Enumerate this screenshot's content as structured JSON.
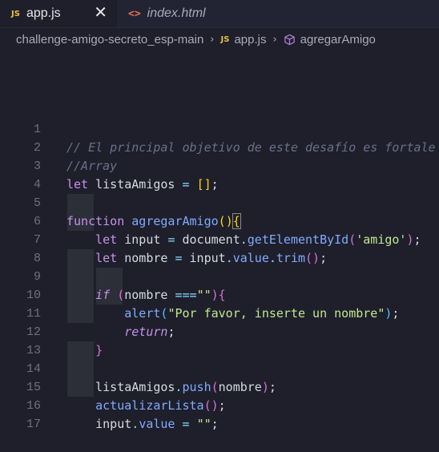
{
  "tabs": [
    {
      "label": "app.js",
      "icon": "JS",
      "active": true,
      "close": "✕"
    },
    {
      "label": "index.html",
      "icon": "<>",
      "active": false
    }
  ],
  "breadcrumb": {
    "folder": "challenge-amigo-secreto_esp-main",
    "file_icon": "JS",
    "file": "app.js",
    "symbol": "agregarAmigo"
  },
  "editor": {
    "line_numbers": [
      "1",
      "2",
      "3",
      "4",
      "5",
      "6",
      "7",
      "8",
      "9",
      "10",
      "11",
      "12",
      "13",
      "14",
      "15",
      "16",
      "17"
    ],
    "comment1": "// El principal objetivo de este desafío es fortale",
    "comment2": "//Array",
    "l3_let": "let",
    "l3_name": " listaAmigos ",
    "l3_eq": "=",
    "l3_sp": " ",
    "l3_open": "[",
    "l3_close": "]",
    "l3_semi": ";",
    "l5_function": "function",
    "l5_name": "agregarAmigo",
    "l5_open_paren": "(",
    "l5_close_paren": ")",
    "l5_brace": "{",
    "l6_let": "let",
    "l6_var": " input ",
    "l6_eq": "=",
    "l6_doc": " document",
    "l6_dot": ".",
    "l6_fn": "getElementById",
    "l6_open": "(",
    "l6_str": "'amigo'",
    "l6_close": ")",
    "l6_semi": ";",
    "l7_let": "let",
    "l7_var": " nombre ",
    "l7_eq": "=",
    "l7_input": " input",
    "l7_dot": ".",
    "l7_prop": "value",
    "l7_dot2": ".",
    "l7_fn": "trim",
    "l7_parens": "()",
    "l7_semi": ";",
    "l9_if": "if",
    "l9_open": " (",
    "l9_var": "nombre ",
    "l9_op": "===",
    "l9_str": "\"\"",
    "l9_close": ")",
    "l9_brace": "{",
    "l10_fn": "alert",
    "l10_open": "(",
    "l10_str": "\"Por favor, inserte un nombre\"",
    "l10_close": ")",
    "l10_semi": ";",
    "l11_return": "return",
    "l11_semi": ";",
    "l12_brace": "}",
    "l14_var": "listaAmigos",
    "l14_dot": ".",
    "l14_fn": "push",
    "l14_open": "(",
    "l14_arg": "nombre",
    "l14_close": ")",
    "l14_semi": ";",
    "l15_fn": "actualizarLista",
    "l15_parens": "()",
    "l15_semi": ";",
    "l16_var": "input",
    "l16_dot": ".",
    "l16_prop": "value",
    "l16_eq": " = ",
    "l16_str": "\"\"",
    "l16_semi": ";"
  },
  "colors": {
    "background": "#1e1f2b",
    "comment": "#6a7087",
    "keyword": "#c792ea",
    "function": "#82aaff",
    "string": "#c3e88d",
    "bracket_gold": "#ffd700",
    "bracket_pink": "#da70d6",
    "bracket_blue": "#4fc1ff"
  }
}
